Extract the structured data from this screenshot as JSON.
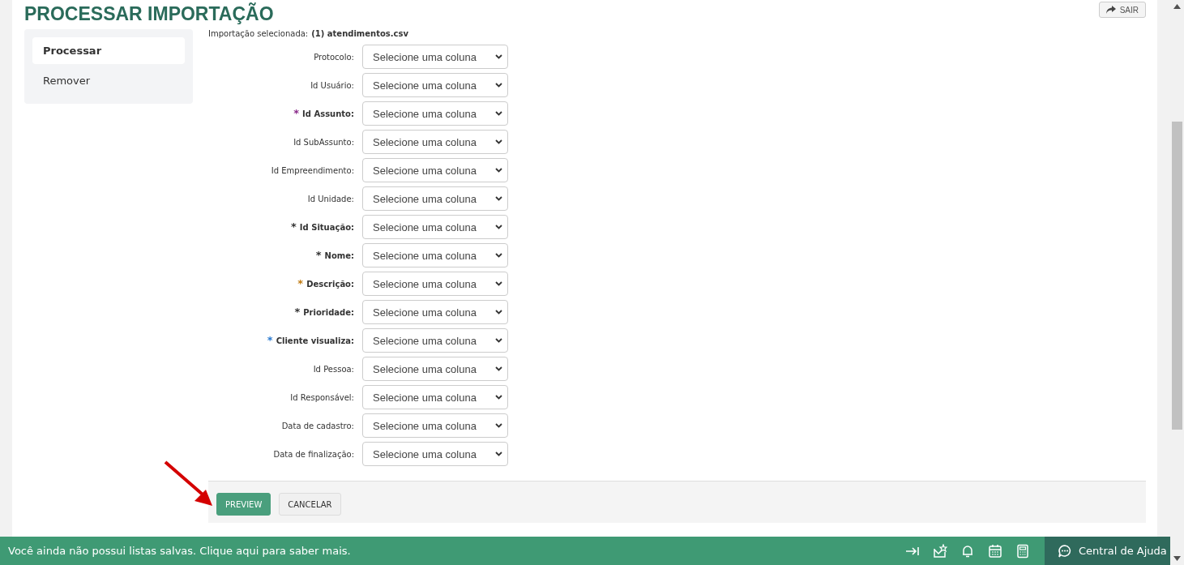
{
  "page": {
    "title": "PROCESSAR IMPORTAÇÃO",
    "exit_button": "SAIR"
  },
  "sidebar": {
    "items": [
      {
        "label": "Processar",
        "selected": true
      },
      {
        "label": "Remover",
        "selected": false
      }
    ]
  },
  "selected_import": {
    "label": "Importação selecionada:",
    "value": "(1) atendimentos.csv"
  },
  "fields": [
    {
      "label": "Protocolo:",
      "required": false,
      "placeholder": "Selecione uma coluna"
    },
    {
      "label": "Id Usuário:",
      "required": false,
      "placeholder": "Selecione uma coluna"
    },
    {
      "label": "Id Assunto:",
      "required": true,
      "marker": "*",
      "color": "#8a2a8a",
      "placeholder": "Selecione uma coluna"
    },
    {
      "label": "Id SubAssunto:",
      "required": false,
      "placeholder": "Selecione uma coluna"
    },
    {
      "label": "Id Empreendimento:",
      "required": false,
      "placeholder": "Selecione uma coluna"
    },
    {
      "label": "Id Unidade:",
      "required": false,
      "placeholder": "Selecione uma coluna"
    },
    {
      "label": "Id Situação:",
      "required": true,
      "marker": "*",
      "color": "#333333",
      "placeholder": "Selecione uma coluna"
    },
    {
      "label": "Nome:",
      "required": true,
      "marker": "*",
      "color": "#333333",
      "placeholder": "Selecione uma coluna"
    },
    {
      "label": "Descrição:",
      "required": true,
      "marker": "*",
      "color": "#c07a10",
      "placeholder": "Selecione uma coluna"
    },
    {
      "label": "Prioridade:",
      "required": true,
      "marker": "*",
      "color": "#333333",
      "placeholder": "Selecione uma coluna"
    },
    {
      "label": "Cliente visualiza:",
      "required": true,
      "marker": "*",
      "color": "#2a7ad0",
      "placeholder": "Selecione uma coluna"
    },
    {
      "label": "Id Pessoa:",
      "required": false,
      "placeholder": "Selecione uma coluna"
    },
    {
      "label": "Id Responsável:",
      "required": false,
      "placeholder": "Selecione uma coluna"
    },
    {
      "label": "Data de cadastro:",
      "required": false,
      "placeholder": "Selecione uma coluna"
    },
    {
      "label": "Data de finalização:",
      "required": false,
      "placeholder": "Selecione uma coluna"
    }
  ],
  "actions": [
    {
      "label": "PREVIEW",
      "kind": "primary"
    },
    {
      "label": "CANCELAR",
      "kind": "secondary"
    }
  ],
  "bottom_bar": {
    "message": "Você ainda não possui listas salvas. Clique aqui para saber mais.",
    "help": "Central de Ajuda"
  }
}
